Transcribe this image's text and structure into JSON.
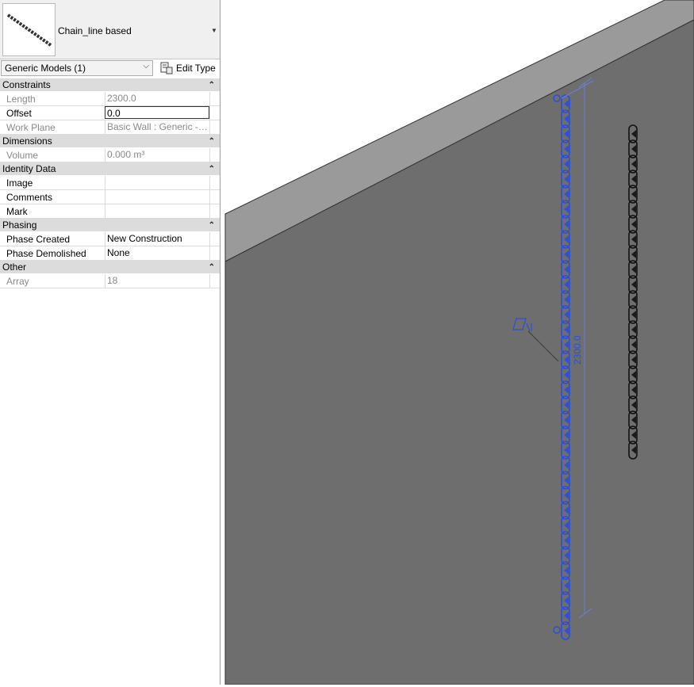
{
  "type_selector": {
    "family_name": "Chain_line based",
    "dropdown_icon": "triangle-down-icon"
  },
  "category": {
    "selected": "Generic Models (1)",
    "edit_type_label": "Edit Type",
    "edit_type_icon": "edit-type-icon"
  },
  "groups": {
    "constraints": {
      "label": "Constraints",
      "rows": [
        {
          "label": "Length",
          "value": "2300.0"
        },
        {
          "label": "Offset",
          "value": "0.0"
        },
        {
          "label": "Work Plane",
          "value": "Basic Wall : Generic - 2..."
        }
      ]
    },
    "dimensions": {
      "label": "Dimensions",
      "rows": [
        {
          "label": "Volume",
          "value": "0.000 m³"
        }
      ]
    },
    "identity": {
      "label": "Identity Data",
      "rows": [
        {
          "label": "Image",
          "value": ""
        },
        {
          "label": "Comments",
          "value": ""
        },
        {
          "label": "Mark",
          "value": ""
        }
      ]
    },
    "phasing": {
      "label": "Phasing",
      "rows": [
        {
          "label": "Phase Created",
          "value": "New Construction"
        },
        {
          "label": "Phase Demolished",
          "value": "None"
        }
      ]
    },
    "other": {
      "label": "Other",
      "rows": [
        {
          "label": "Array",
          "value": "18"
        }
      ]
    }
  },
  "viewport": {
    "dimension_text": "2300.0",
    "selected_color": "#2b4fd6",
    "wall_color": "#6e6e6e",
    "wall_top_color": "#9a9a9a"
  }
}
